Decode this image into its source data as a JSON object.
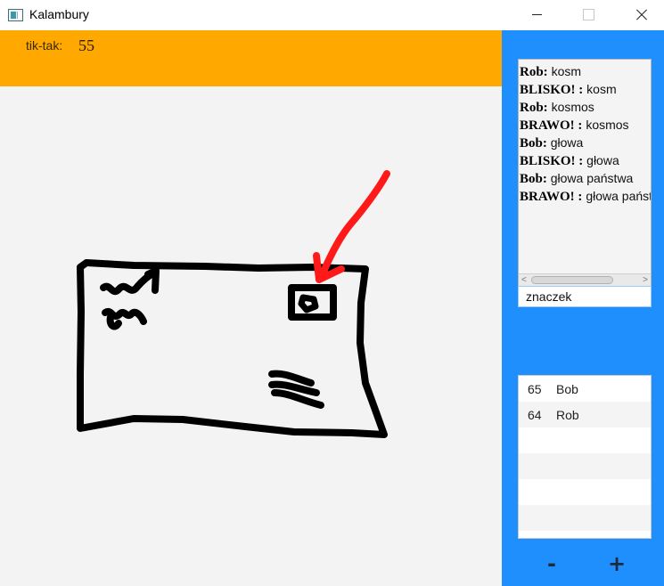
{
  "window": {
    "title": "Kalambury"
  },
  "timer": {
    "label": "tik-tak:",
    "value": "55"
  },
  "chat": {
    "lines": [
      {
        "who": "Rob:",
        "text": "kosm"
      },
      {
        "who": "BLISKO! :",
        "text": " kosm"
      },
      {
        "who": "Rob:",
        "text": "kosmos"
      },
      {
        "who": "BRAWO! :",
        "text": " kosmos"
      },
      {
        "who": "Bob:",
        "text": " głowa"
      },
      {
        "who": "BLISKO! :",
        "text": " głowa"
      },
      {
        "who": "Bob:",
        "text": " głowa państwa"
      },
      {
        "who": "BRAWO! :",
        "text": " głowa państwa"
      }
    ]
  },
  "guess": {
    "value": "znaczek"
  },
  "scores": {
    "rows": [
      {
        "points": "65",
        "name": "Bob"
      },
      {
        "points": "64",
        "name": "Rob"
      },
      {
        "points": "",
        "name": ""
      },
      {
        "points": "",
        "name": ""
      },
      {
        "points": "",
        "name": ""
      },
      {
        "points": "",
        "name": ""
      }
    ]
  },
  "controls": {
    "minus": "-",
    "plus": "+"
  },
  "colors": {
    "timer_bar": "#ffa900",
    "side_panel": "#1f8ffd",
    "drawing_black": "#000000",
    "drawing_red": "#ff1a1a"
  }
}
